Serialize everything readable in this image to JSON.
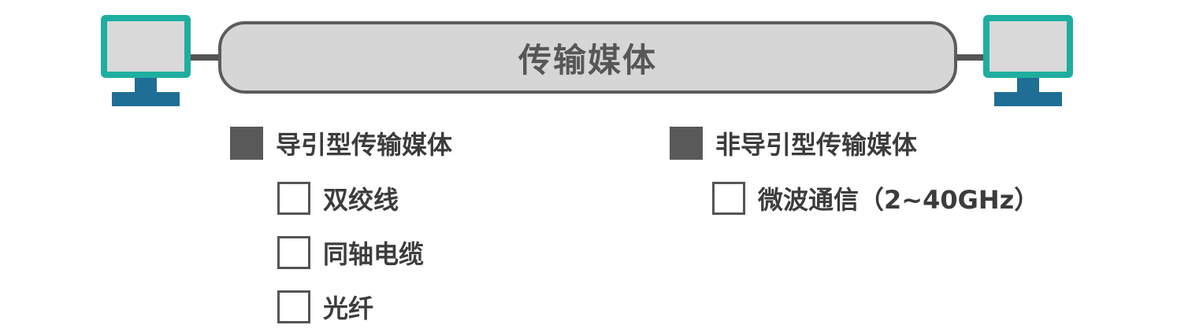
{
  "colors": {
    "monitor_frame": "#1eaea0",
    "monitor_screen": "#d9d9d9",
    "stand": "#1f6e96",
    "bar_fill": "#d6d6d6",
    "bar_border": "#5c5c5c",
    "text": "#3c3c3c"
  },
  "diagram": {
    "title": "传输媒体",
    "guided": {
      "label": "导引型传输媒体",
      "items": [
        "双绞线",
        "同轴电缆",
        "光纤"
      ]
    },
    "unguided": {
      "label": "非导引型传输媒体",
      "items": [
        "微波通信（2~40GHz）"
      ]
    }
  }
}
